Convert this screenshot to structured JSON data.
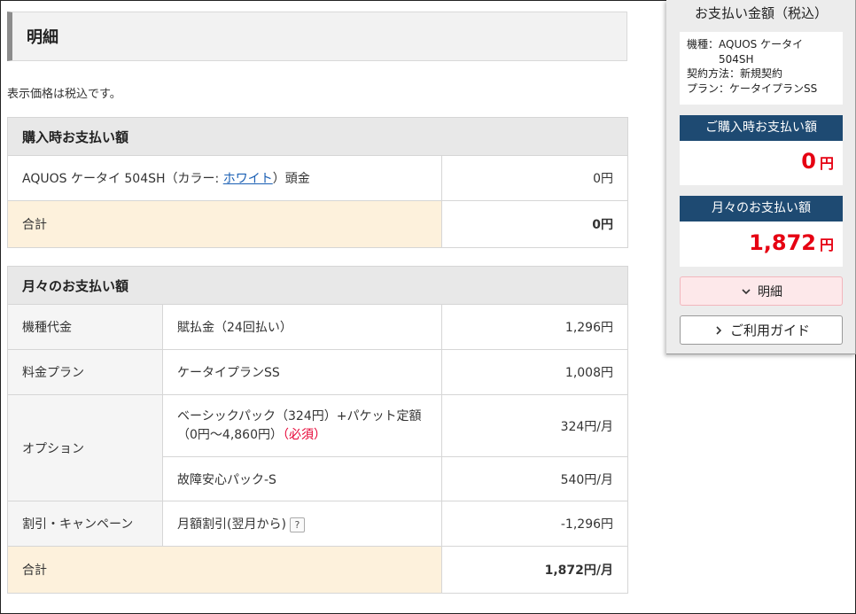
{
  "page": {
    "title": "明細",
    "tax_note": "表示価格は税込です。"
  },
  "purchase": {
    "section_title": "購入時お支払い額",
    "item_prefix": "AQUOS ケータイ 504SH（カラー: ",
    "color_link": "ホワイト",
    "item_suffix": "）頭金",
    "item_amount": "0円",
    "total_label": "合計",
    "total_amount": "0円"
  },
  "monthly": {
    "section_title": "月々のお支払い額",
    "rows": [
      {
        "category": "機種代金",
        "item": "賦払金（24回払い）",
        "amount": "1,296円"
      },
      {
        "category": "料金プラン",
        "item": "ケータイプランSS",
        "amount": "1,008円"
      },
      {
        "category": "オプション",
        "item": "ベーシックパック（324円）+パケット定額（0円～4,860円）",
        "required": "（必須）",
        "amount": "324円/月"
      },
      {
        "item": "故障安心パック-S",
        "amount": "540円/月"
      },
      {
        "category": "割引・キャンペーン",
        "item": "月額割引(翌月から)",
        "help": "?",
        "amount": "-1,296円"
      }
    ],
    "total_label": "合計",
    "total_amount": "1,872円/月"
  },
  "sidebar": {
    "title": "お支払い金額（税込）",
    "model_label": "機種：AQUOS ケータイ",
    "model_cont": "504SH",
    "contract": "契約方法：新規契約",
    "plan": "プラン：ケータイプランSS",
    "purchase_head": "ご購入時お支払い額",
    "purchase_value": "0",
    "purchase_unit": "円",
    "monthly_head": "月々のお支払い額",
    "monthly_value": "1,872",
    "monthly_unit": "円",
    "detail_button": "明細",
    "guide_button": "ご利用ガイド"
  },
  "icons": {
    "detail_button": "chevron-down-icon",
    "guide_button": "chevron-right-icon",
    "help": "question-icon"
  },
  "colors": {
    "accent_red": "#e60033",
    "sidebar_head": "#1e4a72",
    "total_bg": "#fdf1dc"
  }
}
